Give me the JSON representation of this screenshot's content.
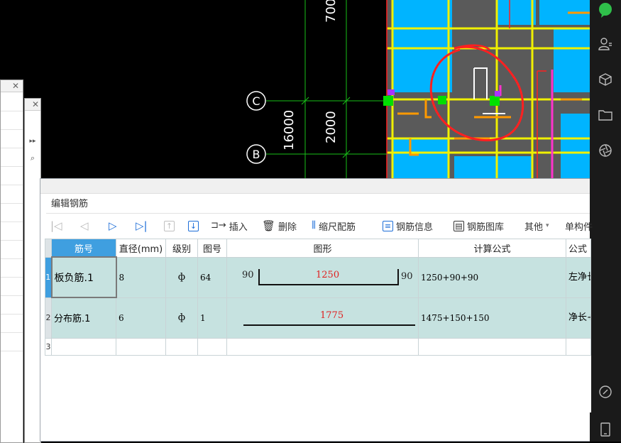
{
  "cad": {
    "dim_700": "700",
    "dim_16000": "16000",
    "dim_2000": "2000",
    "axis_c": "C",
    "axis_b": "B"
  },
  "editor": {
    "title": "编辑钢筋",
    "toolbar": {
      "insert": "插入",
      "delete": "删除",
      "scale_rebar": "缩尺配筋",
      "rebar_info": "钢筋信息",
      "rebar_library": "钢筋图库",
      "other": "其他",
      "unit": "单构件"
    },
    "columns": [
      "筋号",
      "直径(mm)",
      "级别",
      "图号",
      "图形",
      "计算公式",
      "公式"
    ],
    "rows": [
      {
        "index": "1",
        "name": "板负筋.1",
        "diameter": "8",
        "grade": "ф",
        "fig": "64",
        "shape_left": "90",
        "shape_mid": "1250",
        "shape_right": "90",
        "formula": "1250+90+90",
        "note": "左净长+弯折+弯"
      },
      {
        "index": "2",
        "name": "分布筋.1",
        "diameter": "6",
        "grade": "ф",
        "fig": "1",
        "shape_mid": "1775",
        "formula": "1475+150+150",
        "note": "净长+搭接"
      },
      {
        "index": "3"
      }
    ]
  },
  "colors": {
    "header_accent": "#3f9fe0",
    "row_highlight": "#c6e2e0",
    "cad_cyan": "#00b4ff",
    "cad_yellow": "#f0f000",
    "cad_gray": "#5a5a5a"
  }
}
